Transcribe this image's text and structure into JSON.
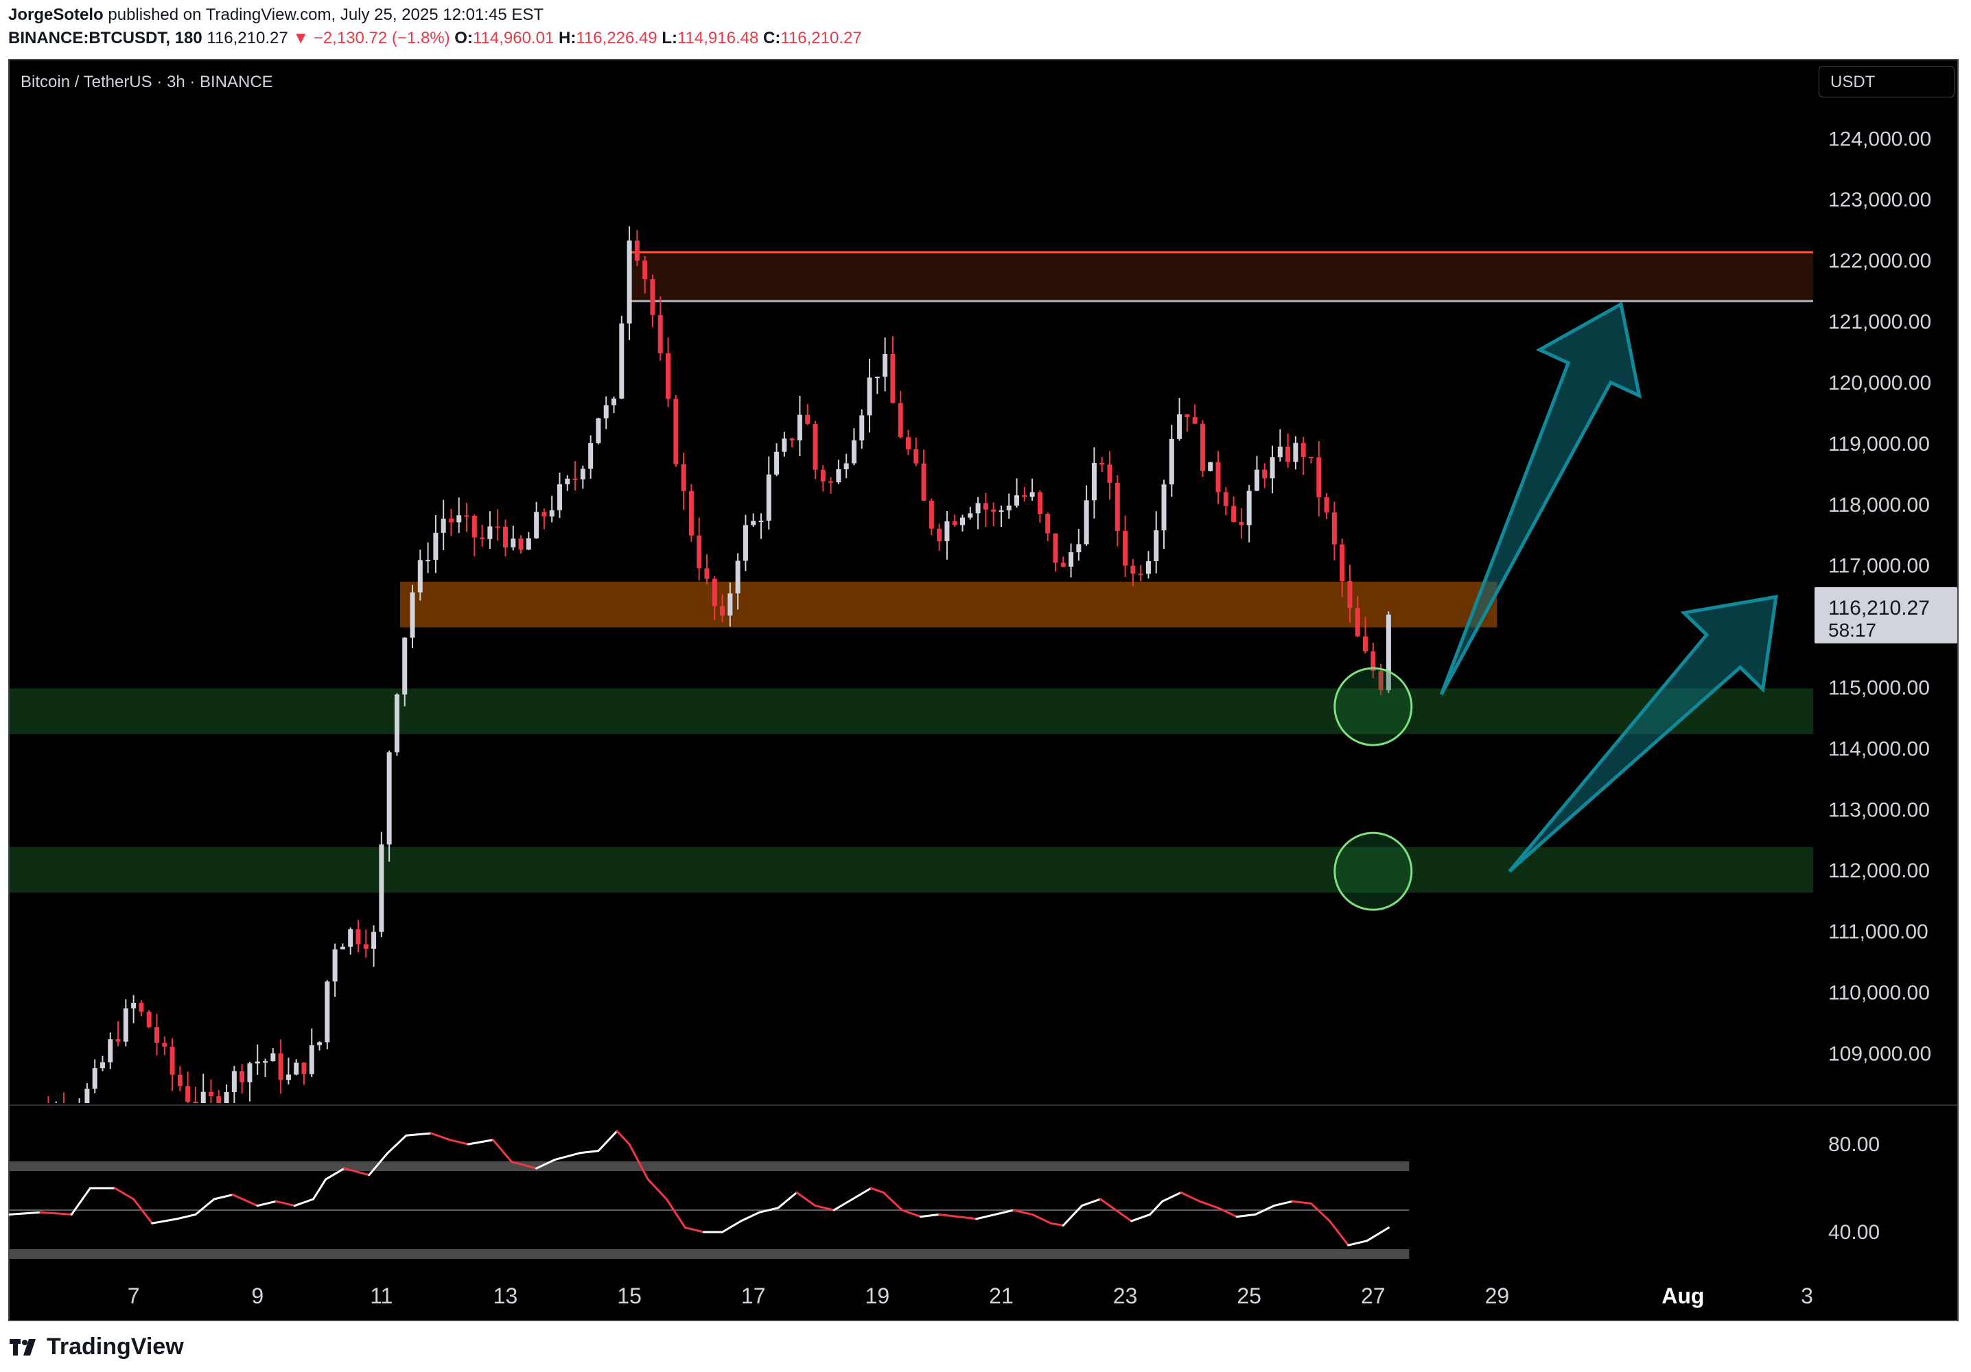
{
  "header": {
    "author": "JorgeSotelo",
    "published": "published on TradingView.com, July 25, 2025 12:01:45 EST",
    "symbol": "BINANCE:BTCUSDT, 180",
    "last": "116,210.27",
    "change": "▼ −2,130.72 (−1.8%)",
    "o_label": "O:",
    "o_val": "114,960.01",
    "h_label": "H:",
    "h_val": "116,226.49",
    "l_label": "L:",
    "l_val": "114,916.48",
    "c_label": "C:",
    "c_val": "116,210.27"
  },
  "chart_title": "Bitcoin / TetherUS · 3h · BINANCE",
  "currency_button": "USDT",
  "price_label": {
    "value": "116,210.27",
    "countdown": "58:17"
  },
  "footer_brand": "TradingView",
  "colors": {
    "up": "#d1d4dc",
    "down": "#f23645",
    "resistance": "#ff5722",
    "demand": "#0e3d17",
    "supply_band": "#6b3300",
    "arrow": "#0f6d7a"
  },
  "chart_data": [
    {
      "type": "candlestick",
      "title": "",
      "ylim": [
        108200,
        124600
      ],
      "y_ticks": [
        109000,
        110000,
        111000,
        112000,
        113000,
        114000,
        115000,
        116000,
        117000,
        118000,
        119000,
        120000,
        121000,
        122000,
        123000,
        124000
      ],
      "y_tick_labels": [
        "109,000.00",
        "110,000.00",
        "111,000.00",
        "112,000.00",
        "113,000.00",
        "114,000.00",
        "115,000.00",
        "116,000.00",
        "117,000.00",
        "118,000.00",
        "119,000.00",
        "120,000.00",
        "121,000.00",
        "122,000.00",
        "123,000.00",
        "124,000.00"
      ],
      "x_ticks": [
        7,
        9,
        11,
        13,
        15,
        17,
        19,
        21,
        23,
        25,
        27,
        29,
        "Aug",
        3
      ],
      "x_tick_labels": [
        "7",
        "9",
        "11",
        "13",
        "15",
        "17",
        "19",
        "21",
        "23",
        "25",
        "27",
        "29",
        "Aug",
        "3"
      ],
      "x_range_days": [
        5.0,
        34.1
      ],
      "anchor_closes": [
        [
          5.0,
          108000
        ],
        [
          5.8,
          108050
        ],
        [
          6.3,
          108400
        ],
        [
          6.7,
          109300
        ],
        [
          7.0,
          109800
        ],
        [
          7.3,
          109400
        ],
        [
          7.6,
          108700
        ],
        [
          7.9,
          108300
        ],
        [
          8.2,
          108150
        ],
        [
          8.5,
          108500
        ],
        [
          8.9,
          108900
        ],
        [
          9.2,
          108900
        ],
        [
          9.5,
          108600
        ],
        [
          9.8,
          108900
        ],
        [
          10.0,
          109200
        ],
        [
          10.2,
          110800
        ],
        [
          10.5,
          111000
        ],
        [
          10.9,
          110900
        ],
        [
          11.1,
          113800
        ],
        [
          11.3,
          115500
        ],
        [
          11.5,
          116600
        ],
        [
          11.8,
          117400
        ],
        [
          12.0,
          117800
        ],
        [
          12.3,
          117700
        ],
        [
          12.6,
          117400
        ],
        [
          12.9,
          117700
        ],
        [
          13.2,
          117100
        ],
        [
          13.5,
          117700
        ],
        [
          13.8,
          118100
        ],
        [
          14.1,
          118400
        ],
        [
          14.3,
          118900
        ],
        [
          14.5,
          119500
        ],
        [
          14.8,
          119600
        ],
        [
          14.95,
          122600
        ],
        [
          15.1,
          122300
        ],
        [
          15.3,
          121600
        ],
        [
          15.6,
          119700
        ],
        [
          15.9,
          118000
        ],
        [
          16.1,
          117200
        ],
        [
          16.3,
          116500
        ],
        [
          16.5,
          116000
        ],
        [
          16.8,
          117500
        ],
        [
          17.1,
          117800
        ],
        [
          17.3,
          118600
        ],
        [
          17.6,
          119100
        ],
        [
          17.8,
          119700
        ],
        [
          18.0,
          118600
        ],
        [
          18.3,
          118300
        ],
        [
          18.6,
          119200
        ],
        [
          18.9,
          120100
        ],
        [
          19.1,
          120400
        ],
        [
          19.3,
          119400
        ],
        [
          19.6,
          118600
        ],
        [
          19.8,
          117800
        ],
        [
          20.0,
          117600
        ],
        [
          20.3,
          117900
        ],
        [
          20.6,
          118100
        ],
        [
          20.9,
          117800
        ],
        [
          21.2,
          118200
        ],
        [
          21.5,
          118100
        ],
        [
          21.8,
          117300
        ],
        [
          22.0,
          116900
        ],
        [
          22.3,
          117700
        ],
        [
          22.6,
          118900
        ],
        [
          22.9,
          117500
        ],
        [
          23.1,
          116800
        ],
        [
          23.4,
          117300
        ],
        [
          23.6,
          118300
        ],
        [
          23.8,
          119500
        ],
        [
          24.0,
          119600
        ],
        [
          24.3,
          118600
        ],
        [
          24.6,
          118200
        ],
        [
          24.9,
          117600
        ],
        [
          25.1,
          118500
        ],
        [
          25.4,
          118700
        ],
        [
          25.7,
          118900
        ],
        [
          25.9,
          118900
        ],
        [
          26.1,
          118300
        ],
        [
          26.3,
          117600
        ],
        [
          26.6,
          116300
        ],
        [
          26.8,
          115600
        ],
        [
          27.0,
          115300
        ],
        [
          27.1,
          114900
        ],
        [
          27.25,
          116210
        ]
      ],
      "levels": [
        {
          "name": "resistance-top",
          "value": 122150,
          "color": "#ff5722"
        },
        {
          "name": "resistance-bottom",
          "value": 121350,
          "color": "#b2b5be"
        }
      ],
      "zones": [
        {
          "name": "supply-zone",
          "from": 121350,
          "to": 122150,
          "x_from": 15.0,
          "x_to": 34.1,
          "color": "#2a1004"
        },
        {
          "name": "retest-zone",
          "from": 116000,
          "to": 116750,
          "x_from": 11.3,
          "x_to": 29.0,
          "color": "#6b3300"
        },
        {
          "name": "demand-zone-1",
          "from": 114250,
          "to": 115000,
          "x_from": 5.0,
          "x_to": 34.1,
          "color": "#0d2e13"
        },
        {
          "name": "demand-zone-2",
          "from": 111650,
          "to": 112400,
          "x_from": 5.0,
          "x_to": 34.1,
          "color": "#0d2e13"
        }
      ],
      "circles": [
        {
          "name": "circle-top",
          "day": 27.0,
          "price": 114700
        },
        {
          "name": "circle-bottom",
          "day": 27.0,
          "price": 112000
        }
      ],
      "arrows": [
        {
          "name": "arrow-1",
          "from": [
            28.1,
            114900
          ],
          "to": [
            31.0,
            121300
          ]
        },
        {
          "name": "arrow-2",
          "from": [
            29.2,
            112000
          ],
          "to": [
            33.5,
            116500
          ]
        }
      ]
    },
    {
      "type": "line",
      "title": "",
      "ylim": [
        20,
        95
      ],
      "y_ticks": [
        40,
        80
      ],
      "y_tick_labels": [
        "40.00",
        "80.00"
      ],
      "bands": [
        70,
        30
      ],
      "midline": 50,
      "anchors": [
        [
          5.0,
          48
        ],
        [
          5.5,
          49
        ],
        [
          6.0,
          48
        ],
        [
          6.3,
          60
        ],
        [
          6.7,
          60
        ],
        [
          7.0,
          55
        ],
        [
          7.3,
          44
        ],
        [
          7.7,
          46
        ],
        [
          8.0,
          48
        ],
        [
          8.3,
          55
        ],
        [
          8.6,
          57
        ],
        [
          9.0,
          52
        ],
        [
          9.3,
          54
        ],
        [
          9.6,
          52
        ],
        [
          9.9,
          55
        ],
        [
          10.1,
          64
        ],
        [
          10.4,
          69
        ],
        [
          10.8,
          66
        ],
        [
          11.1,
          76
        ],
        [
          11.4,
          84
        ],
        [
          11.8,
          85
        ],
        [
          12.1,
          82
        ],
        [
          12.4,
          80
        ],
        [
          12.8,
          82
        ],
        [
          13.1,
          72
        ],
        [
          13.5,
          69
        ],
        [
          13.8,
          73
        ],
        [
          14.2,
          76
        ],
        [
          14.5,
          77
        ],
        [
          14.8,
          86
        ],
        [
          15.0,
          80
        ],
        [
          15.3,
          64
        ],
        [
          15.6,
          55
        ],
        [
          15.9,
          42
        ],
        [
          16.2,
          40
        ],
        [
          16.5,
          40
        ],
        [
          16.8,
          45
        ],
        [
          17.1,
          49
        ],
        [
          17.4,
          51
        ],
        [
          17.7,
          58
        ],
        [
          18.0,
          52
        ],
        [
          18.3,
          50
        ],
        [
          18.6,
          55
        ],
        [
          18.9,
          60
        ],
        [
          19.1,
          58
        ],
        [
          19.4,
          50
        ],
        [
          19.7,
          47
        ],
        [
          20.0,
          48
        ],
        [
          20.3,
          47
        ],
        [
          20.6,
          46
        ],
        [
          20.9,
          48
        ],
        [
          21.2,
          50
        ],
        [
          21.5,
          48
        ],
        [
          21.8,
          44
        ],
        [
          22.0,
          43
        ],
        [
          22.3,
          52
        ],
        [
          22.6,
          55
        ],
        [
          22.9,
          49
        ],
        [
          23.1,
          45
        ],
        [
          23.4,
          48
        ],
        [
          23.6,
          54
        ],
        [
          23.9,
          58
        ],
        [
          24.2,
          54
        ],
        [
          24.5,
          51
        ],
        [
          24.8,
          47
        ],
        [
          25.1,
          48
        ],
        [
          25.4,
          52
        ],
        [
          25.7,
          54
        ],
        [
          26.0,
          53
        ],
        [
          26.3,
          45
        ],
        [
          26.6,
          34
        ],
        [
          26.9,
          36
        ],
        [
          27.25,
          42
        ]
      ]
    }
  ]
}
